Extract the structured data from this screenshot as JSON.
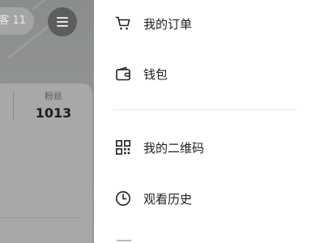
{
  "background": {
    "pill_text": "客 11",
    "stats": [
      {
        "label": "粉丝",
        "value": "1013"
      }
    ]
  },
  "drawer": {
    "items": [
      {
        "label": "我的订单",
        "icon": "cart-icon"
      },
      {
        "label": "钱包",
        "icon": "wallet-icon"
      },
      {
        "label": "我的二维码",
        "icon": "qr-code-icon"
      },
      {
        "label": "观看历史",
        "icon": "clock-icon"
      }
    ]
  },
  "colors": {
    "overlay": "#8f9291",
    "drawer_bg": "#ffffff",
    "text": "#1f1f1f",
    "icon": "#222222"
  }
}
